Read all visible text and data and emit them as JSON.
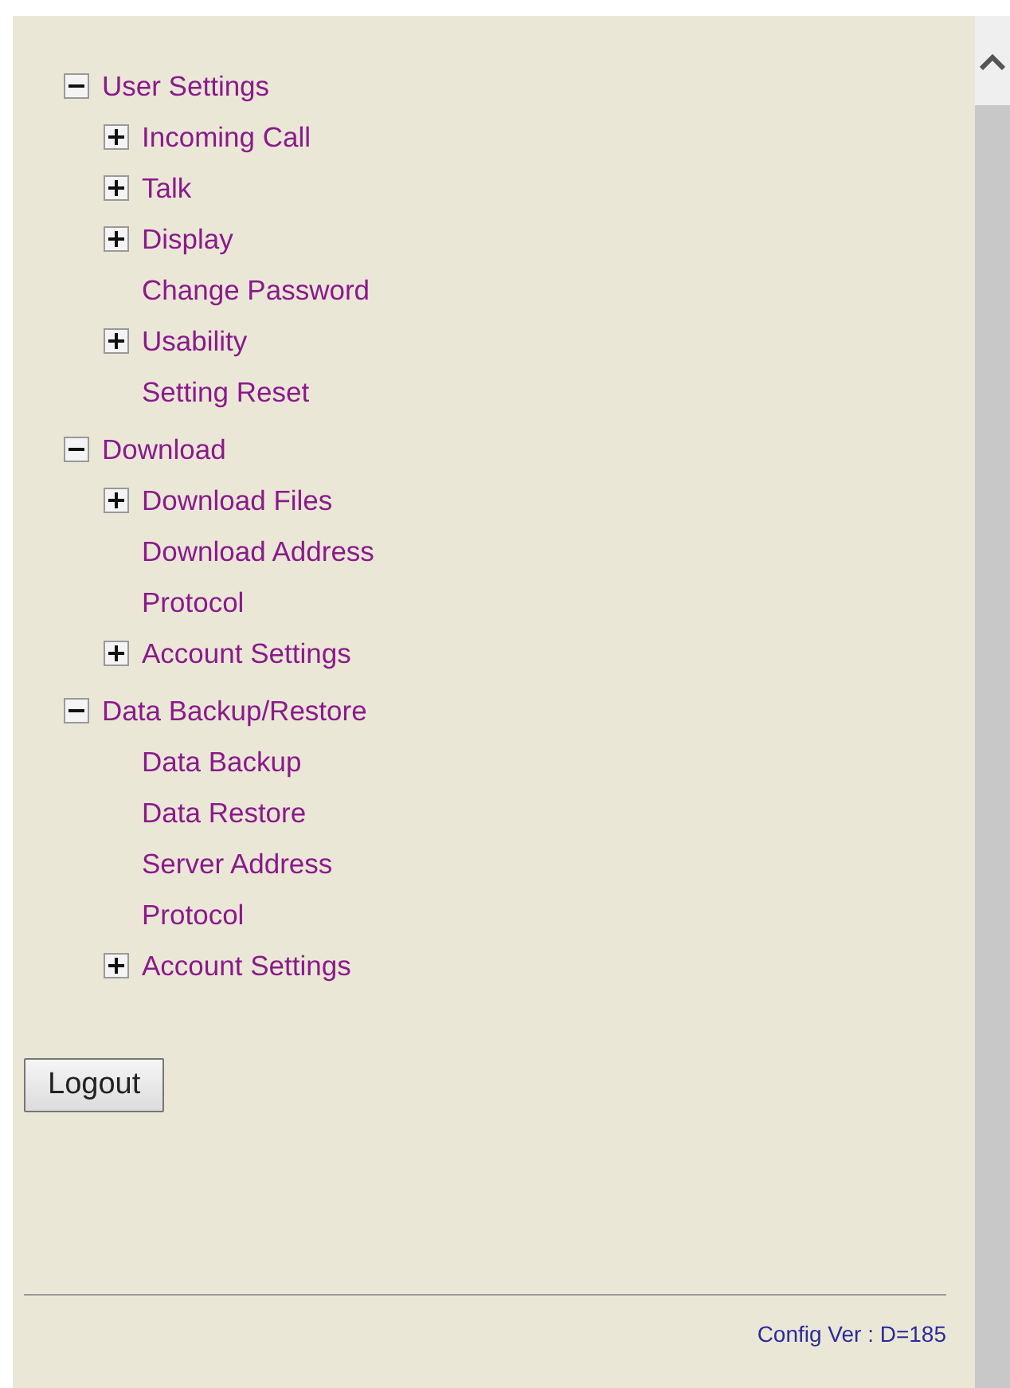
{
  "tree": [
    {
      "label": "User Settings",
      "expanded": true,
      "children": [
        {
          "label": "Incoming Call",
          "expanded": false
        },
        {
          "label": "Talk",
          "expanded": false
        },
        {
          "label": "Display",
          "expanded": false
        },
        {
          "label": "Change Password"
        },
        {
          "label": "Usability",
          "expanded": false
        },
        {
          "label": "Setting Reset"
        }
      ]
    },
    {
      "label": "Download",
      "expanded": true,
      "children": [
        {
          "label": "Download Files",
          "expanded": false
        },
        {
          "label": "Download Address"
        },
        {
          "label": "Protocol"
        },
        {
          "label": "Account Settings",
          "expanded": false
        }
      ]
    },
    {
      "label": "Data Backup/Restore",
      "expanded": true,
      "children": [
        {
          "label": "Data Backup"
        },
        {
          "label": "Data Restore"
        },
        {
          "label": "Server Address"
        },
        {
          "label": "Protocol"
        },
        {
          "label": "Account Settings",
          "expanded": false
        }
      ]
    }
  ],
  "logout_button": "Logout",
  "config_version": "Config Ver : D=185"
}
